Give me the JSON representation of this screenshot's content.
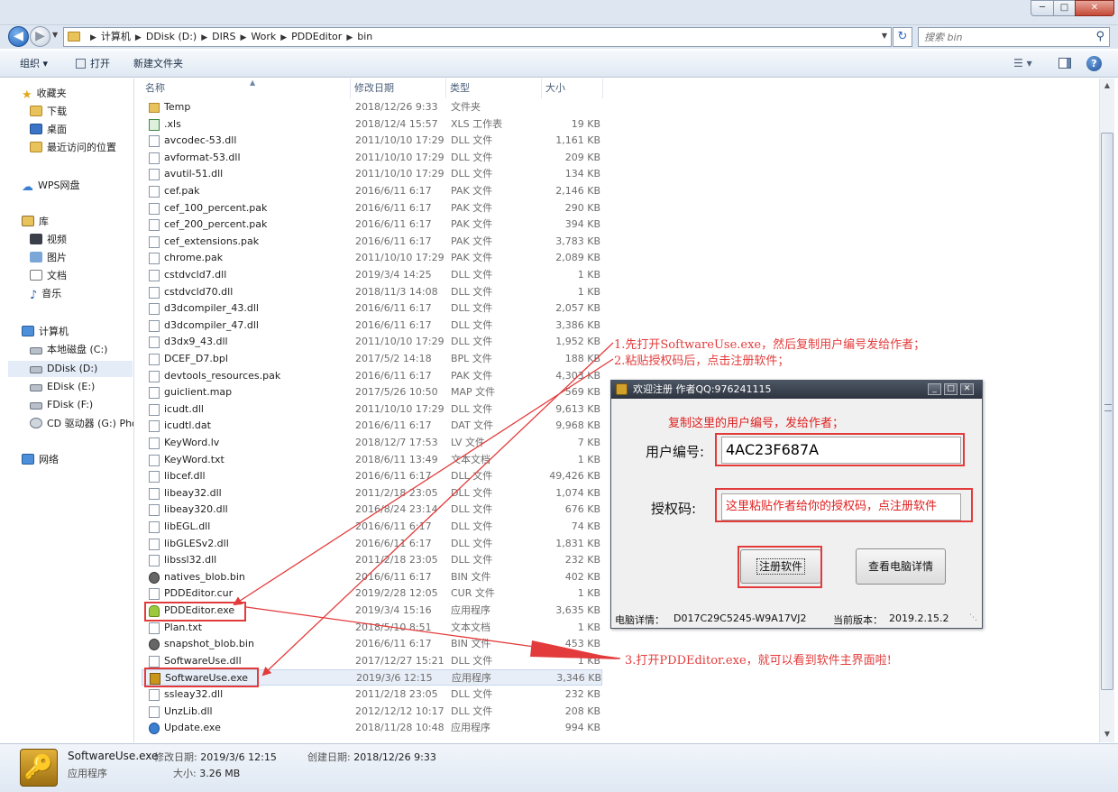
{
  "window": {
    "controls": {
      "minimize": "─",
      "maximize": "□",
      "close": "✕"
    }
  },
  "addressbar": {
    "crumbs": [
      "计算机",
      "DDisk (D:)",
      "DIRS",
      "Work",
      "PDDEditor",
      "bin"
    ],
    "search_placeholder": "搜索 bin"
  },
  "toolbar": {
    "organize": "组织 ▾",
    "open": "打开",
    "new_folder": "新建文件夹"
  },
  "navpane": {
    "items": [
      {
        "label": "收藏夹",
        "icon": "star-icon"
      },
      {
        "label": "下载",
        "icon": "folder-download-icon"
      },
      {
        "label": "桌面",
        "icon": "desktop-icon"
      },
      {
        "label": "最近访问的位置",
        "icon": "recent-places-icon"
      },
      {
        "label": "WPS网盘",
        "icon": "cloud-icon"
      },
      {
        "label": "库",
        "icon": "library-icon"
      },
      {
        "label": "视频",
        "icon": "video-icon"
      },
      {
        "label": "图片",
        "icon": "picture-icon"
      },
      {
        "label": "文档",
        "icon": "document-icon"
      },
      {
        "label": "音乐",
        "icon": "music-icon"
      },
      {
        "label": "计算机",
        "icon": "computer-icon"
      },
      {
        "label": "本地磁盘 (C:)",
        "icon": "drive-icon"
      },
      {
        "label": "DDisk (D:)",
        "icon": "drive-icon"
      },
      {
        "label": "EDisk (E:)",
        "icon": "drive-icon"
      },
      {
        "label": "FDisk (F:)",
        "icon": "drive-icon"
      },
      {
        "label": "CD 驱动器 (G:) Pho",
        "icon": "cd-drive-icon"
      },
      {
        "label": "网络",
        "icon": "network-icon"
      }
    ]
  },
  "filelist": {
    "columns": [
      "名称",
      "修改日期",
      "类型",
      "大小"
    ],
    "files": [
      {
        "name": "Temp",
        "date": "2018/12/26 9:33",
        "type": "文件夹",
        "size": "",
        "icon": "folder"
      },
      {
        "name": ".xls",
        "date": "2018/12/4 15:57",
        "type": "XLS 工作表",
        "size": "19 KB",
        "icon": "xls"
      },
      {
        "name": "avcodec-53.dll",
        "date": "2011/10/10 17:29",
        "type": "DLL 文件",
        "size": "1,161 KB",
        "icon": "file"
      },
      {
        "name": "avformat-53.dll",
        "date": "2011/10/10 17:29",
        "type": "DLL 文件",
        "size": "209 KB",
        "icon": "file"
      },
      {
        "name": "avutil-51.dll",
        "date": "2011/10/10 17:29",
        "type": "DLL 文件",
        "size": "134 KB",
        "icon": "file"
      },
      {
        "name": "cef.pak",
        "date": "2016/6/11 6:17",
        "type": "PAK 文件",
        "size": "2,146 KB",
        "icon": "file"
      },
      {
        "name": "cef_100_percent.pak",
        "date": "2016/6/11 6:17",
        "type": "PAK 文件",
        "size": "290 KB",
        "icon": "file"
      },
      {
        "name": "cef_200_percent.pak",
        "date": "2016/6/11 6:17",
        "type": "PAK 文件",
        "size": "394 KB",
        "icon": "file"
      },
      {
        "name": "cef_extensions.pak",
        "date": "2016/6/11 6:17",
        "type": "PAK 文件",
        "size": "3,783 KB",
        "icon": "file"
      },
      {
        "name": "chrome.pak",
        "date": "2011/10/10 17:29",
        "type": "PAK 文件",
        "size": "2,089 KB",
        "icon": "file"
      },
      {
        "name": "cstdvcld7.dll",
        "date": "2019/3/4 14:25",
        "type": "DLL 文件",
        "size": "1 KB",
        "icon": "file"
      },
      {
        "name": "cstdvcld70.dll",
        "date": "2018/11/3 14:08",
        "type": "DLL 文件",
        "size": "1 KB",
        "icon": "file"
      },
      {
        "name": "d3dcompiler_43.dll",
        "date": "2016/6/11 6:17",
        "type": "DLL 文件",
        "size": "2,057 KB",
        "icon": "file"
      },
      {
        "name": "d3dcompiler_47.dll",
        "date": "2016/6/11 6:17",
        "type": "DLL 文件",
        "size": "3,386 KB",
        "icon": "file"
      },
      {
        "name": "d3dx9_43.dll",
        "date": "2011/10/10 17:29",
        "type": "DLL 文件",
        "size": "1,952 KB",
        "icon": "file"
      },
      {
        "name": "DCEF_D7.bpl",
        "date": "2017/5/2 14:18",
        "type": "BPL 文件",
        "size": "188 KB",
        "icon": "file"
      },
      {
        "name": "devtools_resources.pak",
        "date": "2016/6/11 6:17",
        "type": "PAK 文件",
        "size": "4,303 KB",
        "icon": "file"
      },
      {
        "name": "guiclient.map",
        "date": "2017/5/26 10:50",
        "type": "MAP 文件",
        "size": "569 KB",
        "icon": "file"
      },
      {
        "name": "icudt.dll",
        "date": "2011/10/10 17:29",
        "type": "DLL 文件",
        "size": "9,613 KB",
        "icon": "file"
      },
      {
        "name": "icudtl.dat",
        "date": "2016/6/11 6:17",
        "type": "DAT 文件",
        "size": "9,968 KB",
        "icon": "file"
      },
      {
        "name": "KeyWord.lv",
        "date": "2018/12/7 17:53",
        "type": "LV 文件",
        "size": "7 KB",
        "icon": "file"
      },
      {
        "name": "KeyWord.txt",
        "date": "2018/6/11 13:49",
        "type": "文本文档",
        "size": "1 KB",
        "icon": "file"
      },
      {
        "name": "libcef.dll",
        "date": "2016/6/11 6:17",
        "type": "DLL 文件",
        "size": "49,426 KB",
        "icon": "file"
      },
      {
        "name": "libeay32.dll",
        "date": "2011/2/18 23:05",
        "type": "DLL 文件",
        "size": "1,074 KB",
        "icon": "file"
      },
      {
        "name": "libeay320.dll",
        "date": "2016/8/24 23:14",
        "type": "DLL 文件",
        "size": "676 KB",
        "icon": "file"
      },
      {
        "name": "libEGL.dll",
        "date": "2016/6/11 6:17",
        "type": "DLL 文件",
        "size": "74 KB",
        "icon": "file"
      },
      {
        "name": "libGLESv2.dll",
        "date": "2016/6/11 6:17",
        "type": "DLL 文件",
        "size": "1,831 KB",
        "icon": "file"
      },
      {
        "name": "libssl32.dll",
        "date": "2011/2/18 23:05",
        "type": "DLL 文件",
        "size": "232 KB",
        "icon": "file"
      },
      {
        "name": "natives_blob.bin",
        "date": "2016/6/11 6:17",
        "type": "BIN 文件",
        "size": "402 KB",
        "icon": "bin"
      },
      {
        "name": "PDDEditor.cur",
        "date": "2019/2/28 12:05",
        "type": "CUR 文件",
        "size": "1 KB",
        "icon": "file"
      },
      {
        "name": "PDDEditor.exe",
        "date": "2019/3/4 15:16",
        "type": "应用程序",
        "size": "3,635 KB",
        "icon": "exe-android"
      },
      {
        "name": "Plan.txt",
        "date": "2018/5/10 8:51",
        "type": "文本文档",
        "size": "1 KB",
        "icon": "file"
      },
      {
        "name": "snapshot_blob.bin",
        "date": "2016/6/11 6:17",
        "type": "BIN 文件",
        "size": "453 KB",
        "icon": "bin"
      },
      {
        "name": "SoftwareUse.dll",
        "date": "2017/12/27 15:21",
        "type": "DLL 文件",
        "size": "1 KB",
        "icon": "file"
      },
      {
        "name": "SoftwareUse.exe",
        "date": "2019/3/6 12:15",
        "type": "应用程序",
        "size": "3,346 KB",
        "icon": "exe-key"
      },
      {
        "name": "ssleay32.dll",
        "date": "2011/2/18 23:05",
        "type": "DLL 文件",
        "size": "232 KB",
        "icon": "file"
      },
      {
        "name": "UnzLib.dll",
        "date": "2012/12/12 10:17",
        "type": "DLL 文件",
        "size": "208 KB",
        "icon": "file"
      },
      {
        "name": "Update.exe",
        "date": "2018/11/28 10:48",
        "type": "应用程序",
        "size": "994 KB",
        "icon": "exe-update"
      }
    ]
  },
  "details": {
    "name": "SoftwareUse.exe",
    "type": "应用程序",
    "modified_label": "修改日期:",
    "modified": "2019/3/6 12:15",
    "created_label": "创建日期:",
    "created": "2018/12/26 9:33",
    "size_label": "大小:",
    "size": "3.26 MB"
  },
  "dialog": {
    "title": "欢迎注册 作者QQ:976241115",
    "hint": "复制这里的用户编号，发给作者；",
    "user_id_label": "用户编号:",
    "user_id_value": "4AC23F687A",
    "auth_label": "授权码:",
    "auth_value": "这里粘贴作者给你的授权码，点注册软件",
    "register_button": "注册软件",
    "view_button": "查看电脑详情",
    "pc_label": "电脑详情：",
    "pc_value": "D017C29C5245-W9A17VJ2",
    "version_label": "当前版本：",
    "version_value": "2019.2.15.2"
  },
  "annotations": {
    "step1": "1.先打开SoftwareUse.exe，然后复制用户编号发给作者；",
    "step2": "2.粘贴授权码后，点击注册软件；",
    "step3": "3.打开PDDEditor.exe，就可以看到软件主界面啦!"
  },
  "colors": {
    "annotation_red": "#e33b3b",
    "dialog_title": "#2d3440",
    "selection": "#e8eef7"
  }
}
